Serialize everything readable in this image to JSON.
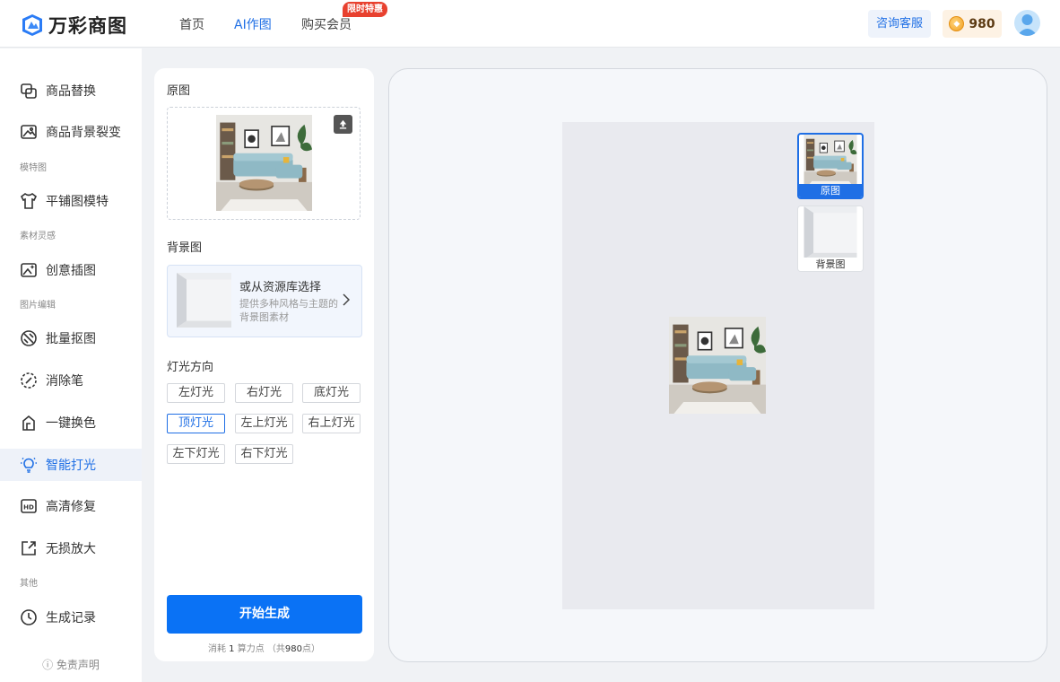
{
  "header": {
    "logo_text": "万彩商图",
    "nav": [
      {
        "label": "首页"
      },
      {
        "label": "AI作图"
      },
      {
        "label": "购买会员"
      }
    ],
    "nav_badge": "限时特惠",
    "service_label": "咨询客服",
    "points": "980"
  },
  "sidebar": {
    "items": [
      {
        "label": "商品替换"
      },
      {
        "label": "商品背景裂变"
      },
      {
        "label": "平铺图模特"
      },
      {
        "label": "创意插图"
      },
      {
        "label": "批量抠图"
      },
      {
        "label": "消除笔"
      },
      {
        "label": "一键换色"
      },
      {
        "label": "智能打光"
      },
      {
        "label": "高清修复"
      },
      {
        "label": "无损放大"
      },
      {
        "label": "生成记录"
      }
    ],
    "groups": [
      "模特图",
      "素材灵感",
      "图片编辑",
      "其他"
    ],
    "disclaimer": "免责声明"
  },
  "form": {
    "original_label": "原图",
    "background_label": "背景图",
    "bg_select_title": "或从资源库选择",
    "bg_select_desc": "提供多种风格与主题的背景图素材",
    "light_label": "灯光方向",
    "light_options": [
      "左灯光",
      "右灯光",
      "底灯光",
      "顶灯光",
      "左上灯光",
      "右上灯光",
      "左下灯光",
      "右下灯光"
    ],
    "light_selected": "顶灯光",
    "generate_label": "开始生成",
    "cost_prefix": "消耗",
    "cost_amount": "1",
    "cost_unit": "算力点",
    "cost_total_prefix": "（共",
    "cost_total": "980",
    "cost_total_suffix": "点）"
  },
  "preview": {
    "layers": [
      {
        "label": "原图",
        "selected": true
      },
      {
        "label": "背景图",
        "selected": false
      }
    ]
  },
  "colors": {
    "accent": "#1f6fe5",
    "primary_button": "#0a72f5",
    "badge": "#e8412f",
    "canvas": "#e9eaef"
  },
  "icons": {
    "upload": "upload-icon",
    "chevron": "chevron-right-icon",
    "coin": "coin-icon",
    "info": "info-icon"
  }
}
